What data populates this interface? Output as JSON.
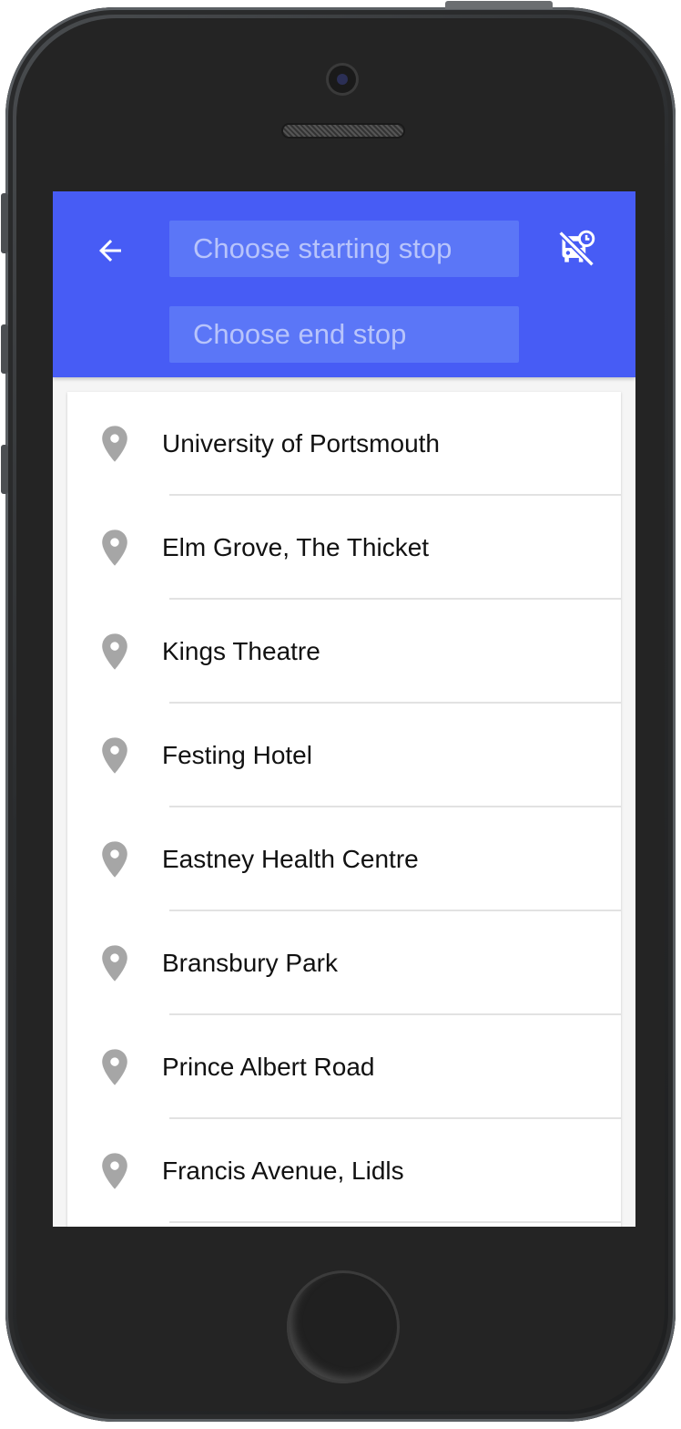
{
  "header": {
    "start_placeholder": "Choose starting stop",
    "end_placeholder": "Choose end stop",
    "start_value": "",
    "end_value": ""
  },
  "icons": {
    "back": "arrow-back-icon",
    "bus_off": "bus-off-icon",
    "stop": "location-pin-icon"
  },
  "colors": {
    "app_bar": "#475cf5",
    "input_background": "#5b76f7",
    "pin": "#a6a6a6"
  },
  "stops": [
    {
      "name": "University of Portsmouth"
    },
    {
      "name": "Elm Grove, The Thicket"
    },
    {
      "name": "Kings Theatre"
    },
    {
      "name": "Festing Hotel"
    },
    {
      "name": "Eastney Health Centre"
    },
    {
      "name": "Bransbury Park"
    },
    {
      "name": "Prince Albert Road"
    },
    {
      "name": "Francis Avenue, Lidls"
    }
  ]
}
